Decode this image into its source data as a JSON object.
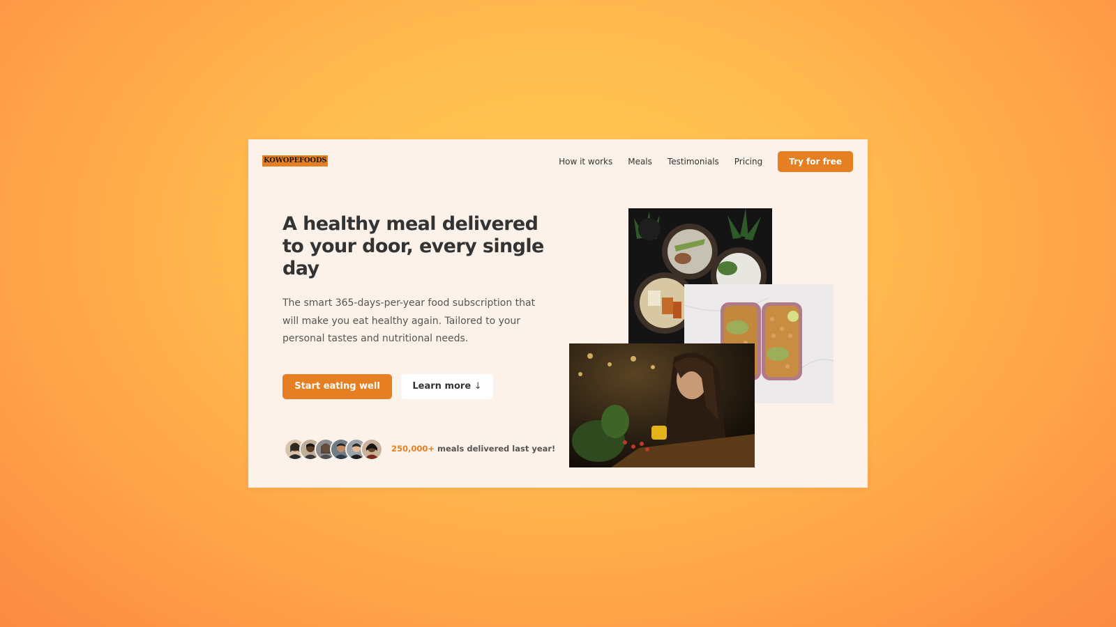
{
  "brand": {
    "logo_text": "KOWOPEFOODS",
    "accent_color": "#e67e22",
    "card_background": "#fdf2e9"
  },
  "nav": {
    "links": [
      {
        "label": "How it works"
      },
      {
        "label": "Meals"
      },
      {
        "label": "Testimonials"
      },
      {
        "label": "Pricing"
      }
    ],
    "cta_label": "Try for free"
  },
  "hero": {
    "title": "A healthy meal delivered to your door, every single day",
    "description": "The smart 365-days-per-year food subscription that will make you eat healthy again. Tailored to your personal tastes and nutritional needs.",
    "primary_button": "Start eating well",
    "secondary_button": "Learn more",
    "secondary_button_icon": "↓"
  },
  "delivered": {
    "count": "250,000+",
    "text": " meals delivered last year!",
    "avatar_count": 6
  },
  "images": [
    {
      "name": "meal-bowls-photo"
    },
    {
      "name": "meal-prep-boxes-photo"
    },
    {
      "name": "woman-eating-photo"
    }
  ]
}
